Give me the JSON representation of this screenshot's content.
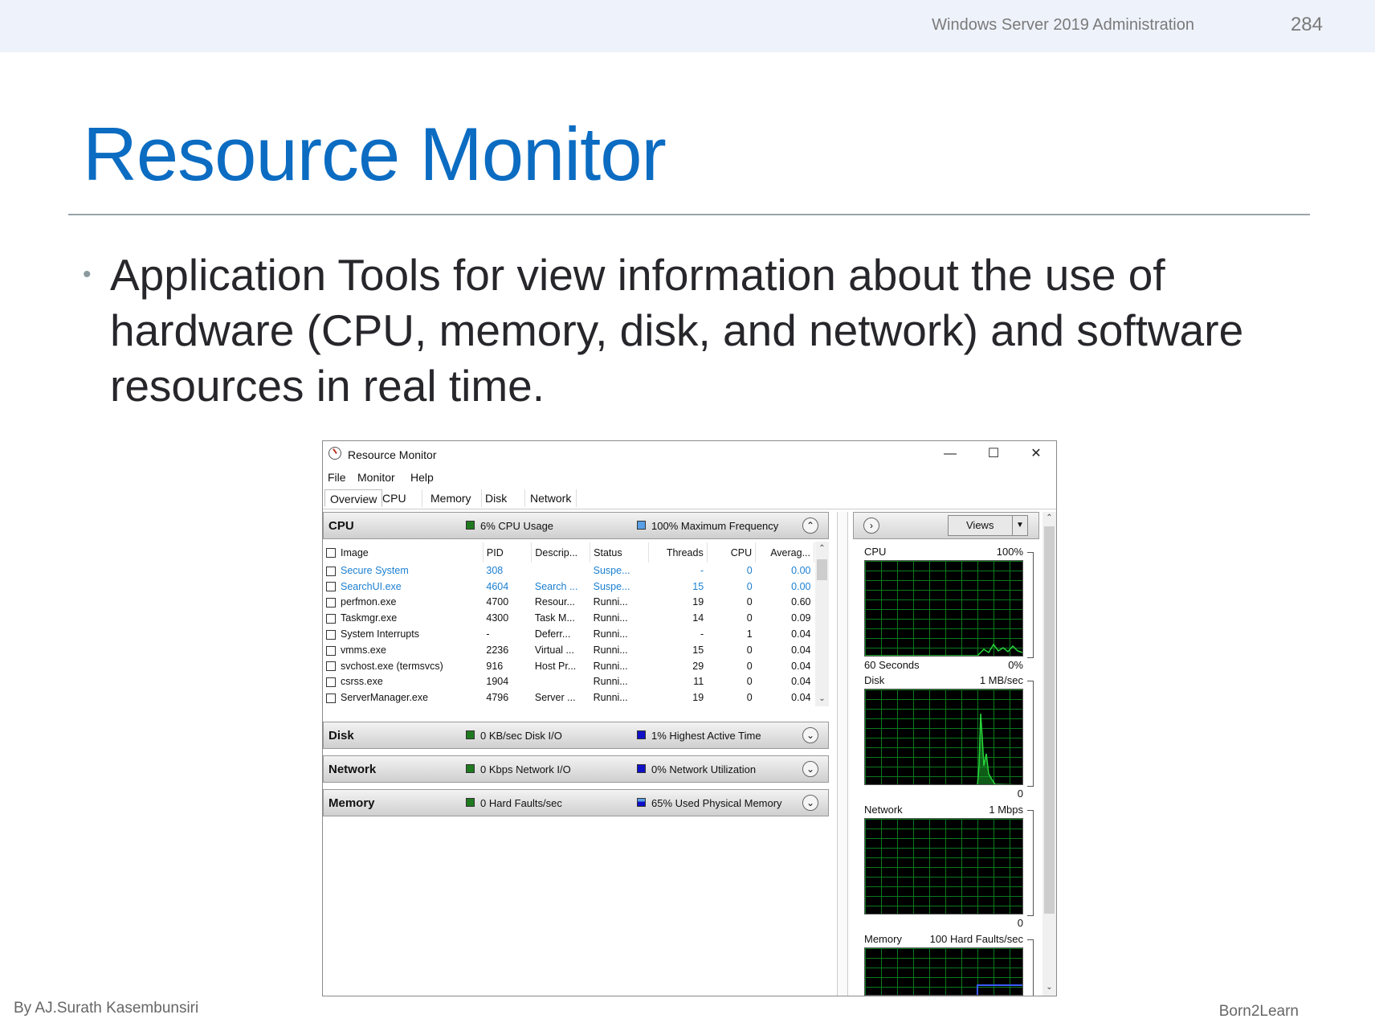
{
  "slide": {
    "course": "Windows Server 2019 Administration",
    "page_number": "284",
    "title": "Resource Monitor",
    "bullet": "Application Tools for view information about the use of hardware (CPU, memory, disk, and network) and software resources in real time.",
    "footer_left": "By AJ.Surath Kasembunsiri",
    "footer_right": "Born2Learn"
  },
  "window": {
    "title": "Resource Monitor",
    "menu": [
      "File",
      "Monitor",
      "Help"
    ],
    "tabs": [
      "Overview",
      "CPU",
      "Memory",
      "Disk",
      "Network"
    ],
    "active_tab": "Overview"
  },
  "sections": {
    "cpu": {
      "name": "CPU",
      "stat1": "6% CPU Usage",
      "stat2": "100% Maximum Frequency"
    },
    "disk": {
      "name": "Disk",
      "stat1": "0 KB/sec Disk I/O",
      "stat2": "1% Highest Active Time"
    },
    "network": {
      "name": "Network",
      "stat1": "0 Kbps Network I/O",
      "stat2": "0% Network Utilization"
    },
    "memory": {
      "name": "Memory",
      "stat1": "0 Hard Faults/sec",
      "stat2": "65% Used Physical Memory"
    }
  },
  "colors": {
    "green": "#1f7a1f",
    "blue": "#1010c8",
    "lightblue": "#5aa0e6",
    "title_blue": "#0b6cc2"
  },
  "process_table": {
    "columns": [
      "Image",
      "PID",
      "Descrip...",
      "Status",
      "Threads",
      "CPU",
      "Averag..."
    ],
    "rows": [
      {
        "image": "Secure System",
        "pid": "308",
        "desc": "",
        "status": "Suspe...",
        "threads": "-",
        "cpu": "0",
        "avg": "0.00",
        "highlight": true
      },
      {
        "image": "SearchUI.exe",
        "pid": "4604",
        "desc": "Search ...",
        "status": "Suspe...",
        "threads": "15",
        "cpu": "0",
        "avg": "0.00",
        "highlight": true
      },
      {
        "image": "perfmon.exe",
        "pid": "4700",
        "desc": "Resour...",
        "status": "Runni...",
        "threads": "19",
        "cpu": "0",
        "avg": "0.60"
      },
      {
        "image": "Taskmgr.exe",
        "pid": "4300",
        "desc": "Task M...",
        "status": "Runni...",
        "threads": "14",
        "cpu": "0",
        "avg": "0.09"
      },
      {
        "image": "System Interrupts",
        "pid": "-",
        "desc": "Deferr...",
        "status": "Runni...",
        "threads": "-",
        "cpu": "1",
        "avg": "0.04"
      },
      {
        "image": "vmms.exe",
        "pid": "2236",
        "desc": "Virtual ...",
        "status": "Runni...",
        "threads": "15",
        "cpu": "0",
        "avg": "0.04"
      },
      {
        "image": "svchost.exe (termsvcs)",
        "pid": "916",
        "desc": "Host Pr...",
        "status": "Runni...",
        "threads": "29",
        "cpu": "0",
        "avg": "0.04"
      },
      {
        "image": "csrss.exe",
        "pid": "1904",
        "desc": "",
        "status": "Runni...",
        "threads": "11",
        "cpu": "0",
        "avg": "0.04"
      },
      {
        "image": "ServerManager.exe",
        "pid": "4796",
        "desc": "Server ...",
        "status": "Runni...",
        "threads": "19",
        "cpu": "0",
        "avg": "0.04"
      }
    ]
  },
  "right_panel": {
    "views_label": "Views",
    "graphs": {
      "cpu": {
        "label": "CPU",
        "max": "100%",
        "time": "60 Seconds",
        "min": "0%"
      },
      "disk": {
        "label": "Disk",
        "max": "1 MB/sec",
        "min": "0"
      },
      "network": {
        "label": "Network",
        "max": "1 Mbps",
        "min": "0"
      },
      "memory": {
        "label": "Memory",
        "max": "100 Hard Faults/sec"
      }
    }
  }
}
